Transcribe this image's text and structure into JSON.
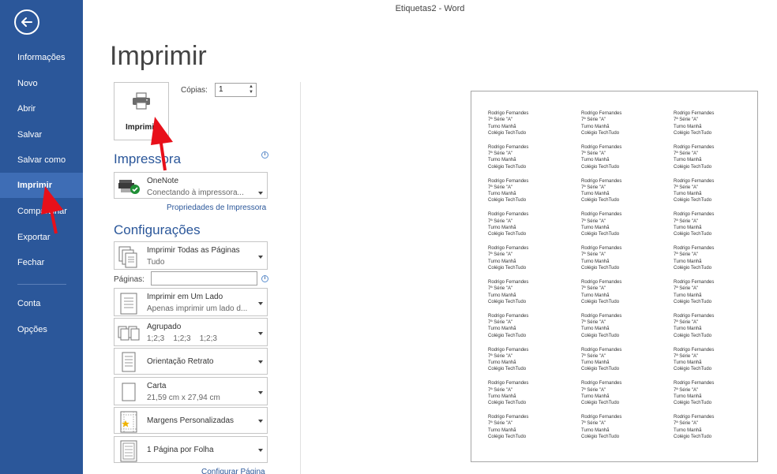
{
  "window": {
    "title": "Etiquetas2 - Word"
  },
  "sidebar": {
    "items": [
      {
        "label": "Informações"
      },
      {
        "label": "Novo"
      },
      {
        "label": "Abrir"
      },
      {
        "label": "Salvar"
      },
      {
        "label": "Salvar como"
      },
      {
        "label": "Imprimir",
        "active": true
      },
      {
        "label": "Compartilhar"
      },
      {
        "label": "Exportar"
      },
      {
        "label": "Fechar"
      },
      {
        "label": "Conta"
      },
      {
        "label": "Opções"
      }
    ]
  },
  "main": {
    "title": "Imprimir",
    "print_button": "Imprimir",
    "copies_label": "Cópias:",
    "copies_value": "1",
    "printer_section": "Impressora",
    "printer": {
      "name": "OneNote",
      "status": "Conectando à impressora..."
    },
    "printer_properties_link": "Propriedades de Impressora",
    "settings_section": "Configurações",
    "settings": [
      {
        "line1": "Imprimir Todas as Páginas",
        "line2": "Tudo"
      },
      {
        "line1": "Imprimir em Um Lado",
        "line2": "Apenas imprimir um lado d..."
      },
      {
        "line1": "Agrupado",
        "line2": "1;2;3    1;2;3    1;2;3"
      },
      {
        "line1": "Orientação Retrato"
      },
      {
        "line1": "Carta",
        "line2": "21,59 cm x 27,94 cm"
      },
      {
        "line1": "Margens Personalizadas"
      },
      {
        "line1": "1 Página por Folha"
      }
    ],
    "pages_label": "Páginas:",
    "pages_value": "",
    "page_setup_link": "Configurar Página"
  },
  "preview": {
    "label_lines": [
      "Rodrigo Fernandes",
      "7ª Série \"A\"",
      "Turno Manhã",
      "Colégio TechTudo"
    ],
    "rows": 10,
    "columns": 3
  },
  "colors": {
    "sidebar": "#2b579a",
    "sidebar_active": "#3e6db5",
    "accent": "#2b579a",
    "arrow": "#e8101a"
  }
}
